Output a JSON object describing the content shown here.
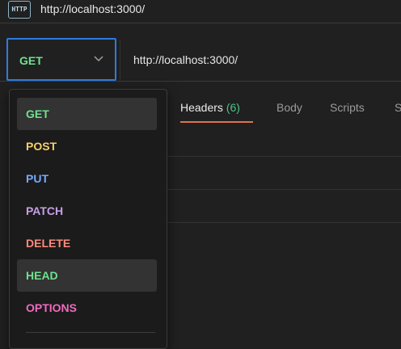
{
  "tab": {
    "icon_text": "HTTP",
    "title": "http://localhost:3000/"
  },
  "request": {
    "method": "GET",
    "method_color": "#6ee28f",
    "url": "http://localhost:3000/"
  },
  "tabs": [
    {
      "label": "Headers",
      "count": "(6)",
      "active": true
    },
    {
      "label": "Body"
    },
    {
      "label": "Scripts"
    },
    {
      "label": "S"
    }
  ],
  "methods_menu": {
    "options": [
      {
        "label": "GET",
        "color": "#6ee28f",
        "highlighted": true
      },
      {
        "label": "POST",
        "color": "#f5d06a"
      },
      {
        "label": "PUT",
        "color": "#76a9ff"
      },
      {
        "label": "PATCH",
        "color": "#c8a0e6"
      },
      {
        "label": "DELETE",
        "color": "#ff8a7a"
      },
      {
        "label": "HEAD",
        "color": "#6ee28f",
        "highlighted": true
      },
      {
        "label": "OPTIONS",
        "color": "#f06bbf"
      }
    ]
  },
  "colors": {
    "focus_border": "#2d7be0",
    "active_tab_underline": "#e1724a",
    "count": "#4fc28a"
  }
}
